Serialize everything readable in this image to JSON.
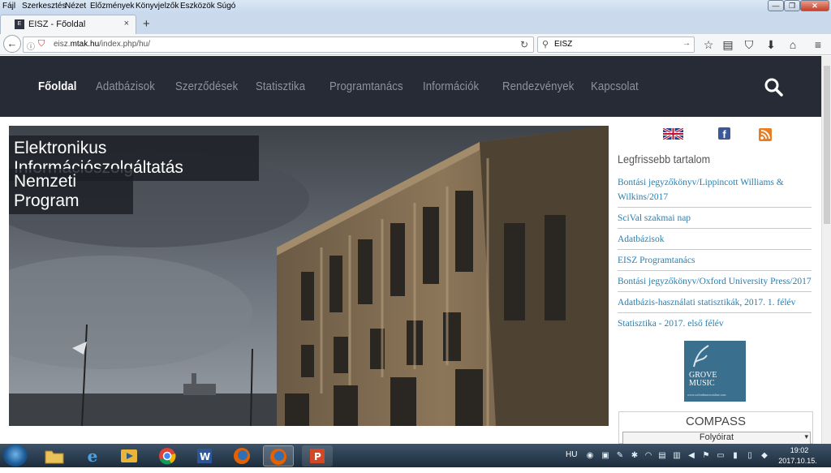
{
  "menubar": {
    "items": [
      "Fájl",
      "Szerkesztés",
      "Nézet",
      "Előzmények",
      "Könyvjelzők",
      "Eszközök",
      "Súgó"
    ]
  },
  "tab": {
    "title": "EISZ - Főoldal",
    "close": "×",
    "new_tab": "+"
  },
  "address": {
    "url_prefix": "eisz.",
    "url_domain": "mtak.hu",
    "url_path": "/index.php/hu/"
  },
  "search": {
    "value": "EISZ"
  },
  "site_nav": {
    "items": [
      "Főoldal",
      "Adatbázisok",
      "Szerződések",
      "Statisztika",
      "Programtanács",
      "Információk",
      "Rendezvények",
      "Kapcsolat"
    ]
  },
  "hero": {
    "line1": "Elektronikus Információszolgáltatás",
    "line2": "Nemzeti Program"
  },
  "sidebar": {
    "latest_title": "Legfrissebb tartalom",
    "latest_items": [
      "Bontási jegyzőkönyv/Lippincott Williams & Wilkins/2017",
      "SciVal szakmai nap",
      "Adatbázisok",
      "EISZ Programtanács",
      "Bontási jegyzőkönyv/Oxford University Press/2017",
      "Adatbázis-használati statisztikák, 2017. 1. félév",
      "Statisztika - 2017. első félév"
    ],
    "grove_line1": "GROVE",
    "grove_line2": "MUSIC",
    "grove_url": "www.oxfordmusiconline.com",
    "compass_title": "COMPASS",
    "compass_select": "Folyóirat"
  },
  "taskbar": {
    "lang": "HU",
    "time": "19:02",
    "date": "2017.10.15."
  },
  "colors": {
    "nav_bg": "#262b35",
    "link": "#2a7fb0",
    "nav_inactive": "#8c93a0"
  }
}
